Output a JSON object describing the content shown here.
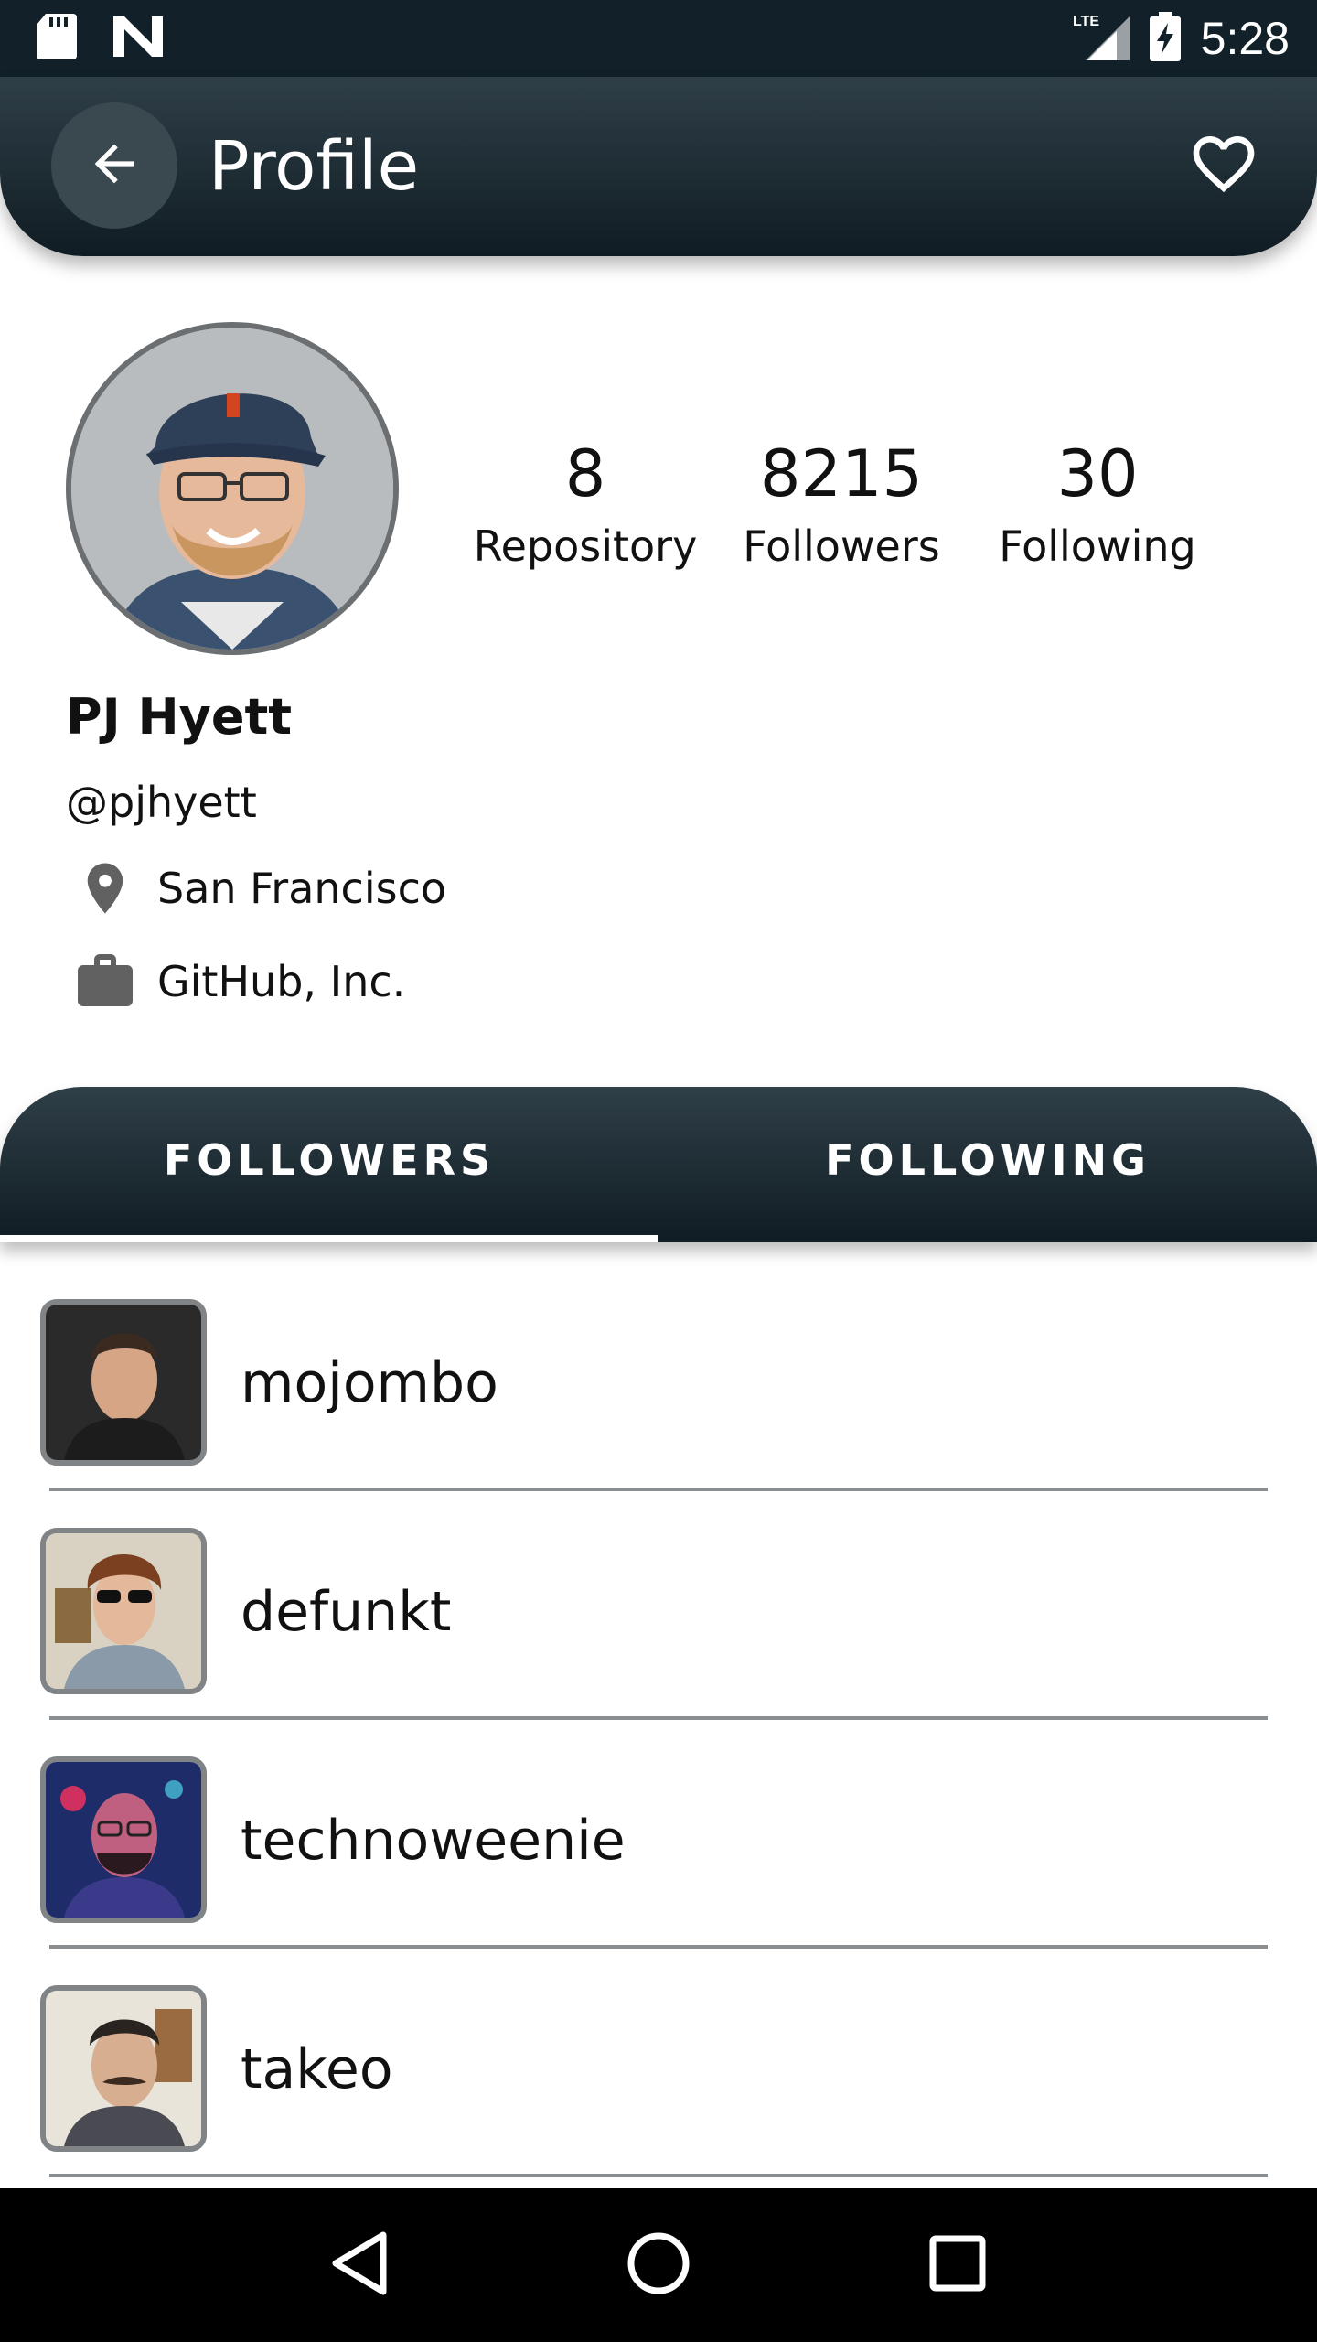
{
  "status_bar": {
    "time": "5:28",
    "network": "LTE",
    "icons": [
      "sd-card-icon",
      "n-notification-icon",
      "signal-icon",
      "battery-charging-icon"
    ]
  },
  "app_bar": {
    "title": "Profile",
    "back_icon": "arrow-left-icon",
    "favorite_icon": "heart-outline-icon"
  },
  "profile": {
    "name": "PJ Hyett",
    "handle": "@pjhyett",
    "location": "San Francisco",
    "company": "GitHub, Inc.",
    "stats": [
      {
        "value": "8",
        "label": "Repository"
      },
      {
        "value": "8215",
        "label": "Followers"
      },
      {
        "value": "30",
        "label": "Following"
      }
    ]
  },
  "tabs": [
    {
      "label": "FOLLOWERS",
      "active": true
    },
    {
      "label": "FOLLOWING",
      "active": false
    }
  ],
  "followers": [
    {
      "username": "mojombo"
    },
    {
      "username": "defunkt"
    },
    {
      "username": "technoweenie"
    },
    {
      "username": "takeo"
    }
  ],
  "colors": {
    "header_dark": "#122029",
    "header_light": "#2f3f48",
    "divider": "#8a8e90"
  }
}
